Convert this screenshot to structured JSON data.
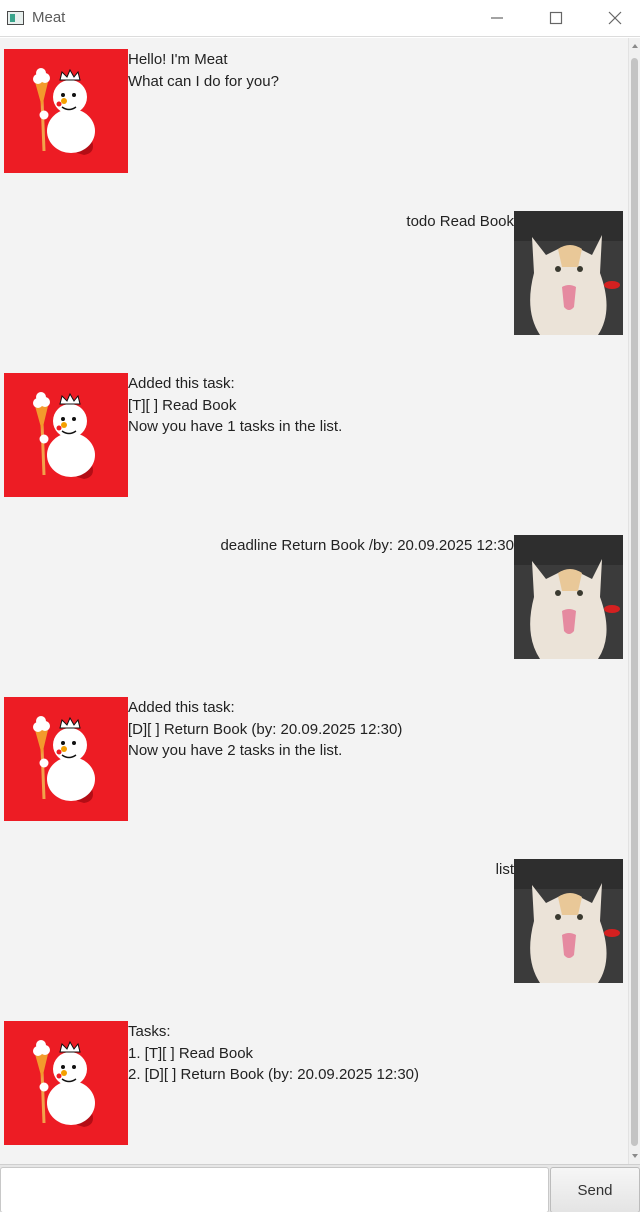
{
  "window": {
    "title": "Meat",
    "minimize_icon": "minimize-icon",
    "maximize_icon": "maximize-icon",
    "close_icon": "close-icon"
  },
  "colors": {
    "bot_avatar_bg": "#ed1c24",
    "chat_bg": "#f3f3f3"
  },
  "dialogs": [
    {
      "speaker": "bot",
      "text": "Hello! I'm Meat\nWhat can I do for you?"
    },
    {
      "speaker": "user",
      "text": "todo Read Book"
    },
    {
      "speaker": "bot",
      "text": "Added this task:\n[T][ ] Read Book\nNow you have 1 tasks in the list."
    },
    {
      "speaker": "user",
      "text": "deadline Return Book /by: 20.09.2025 12:30"
    },
    {
      "speaker": "bot",
      "text": "Added this task:\n[D][ ] Return Book (by: 20.09.2025 12:30)\nNow you have 2 tasks in the list."
    },
    {
      "speaker": "user",
      "text": "list"
    },
    {
      "speaker": "bot",
      "text": "Tasks:\n1. [T][ ] Read Book\n2. [D][ ] Return Book (by: 20.09.2025 12:30)"
    }
  ],
  "input": {
    "value": "",
    "placeholder": ""
  },
  "send_button": {
    "label": "Send"
  }
}
